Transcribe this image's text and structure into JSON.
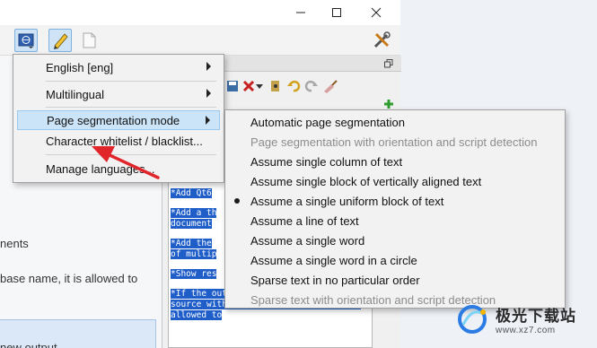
{
  "left_pane": {
    "text1": "nents",
    "text2": "base name, it is allowed to",
    "text3": "new output"
  },
  "editor": {
    "line1": "*Add Qt6",
    "line2a": "*Add a th",
    "line2b": "document",
    "line3a": "*Add the",
    "line3b": "of multip",
    "line4": "*Show res",
    "line5a": "*If the output file exists next to a",
    "line5b": "source with the same base name, it is",
    "line5c": "allowed to"
  },
  "menu": {
    "items": [
      {
        "label": "English [eng]",
        "has_submenu": true
      },
      {
        "label": "Multilingual",
        "has_submenu": true
      },
      {
        "label": "Page segmentation mode",
        "has_submenu": true
      },
      {
        "label": "Character whitelist / blacklist...",
        "has_submenu": false
      },
      {
        "label": "Manage languages...",
        "has_submenu": false
      }
    ]
  },
  "submenu": {
    "items": [
      {
        "label": "Automatic page segmentation",
        "enabled": true,
        "checked": false
      },
      {
        "label": "Page segmentation with orientation and script detection",
        "enabled": false,
        "checked": false
      },
      {
        "label": "Assume single column of text",
        "enabled": true,
        "checked": false
      },
      {
        "label": "Assume single block of vertically aligned text",
        "enabled": true,
        "checked": false
      },
      {
        "label": "Assume a single uniform block of text",
        "enabled": true,
        "checked": true
      },
      {
        "label": "Assume a line of text",
        "enabled": true,
        "checked": false
      },
      {
        "label": "Assume a single word",
        "enabled": true,
        "checked": false
      },
      {
        "label": "Assume a single word in a circle",
        "enabled": true,
        "checked": false
      },
      {
        "label": "Sparse text in no particular order",
        "enabled": true,
        "checked": false
      },
      {
        "label": "Sparse text with orientation and script detection",
        "enabled": false,
        "checked": false
      }
    ]
  },
  "watermark": {
    "title": "极光下载站",
    "url": "www.xz7.com"
  },
  "colors": {
    "selection": "#1f5ec9",
    "menu_highlight": "#cce4f7",
    "annotation_arrow": "#e0252b"
  },
  "icons": [
    "minimize-icon",
    "maximize-icon",
    "close-icon",
    "language-icon",
    "pencil-icon",
    "page-icon",
    "tools-icon"
  ]
}
